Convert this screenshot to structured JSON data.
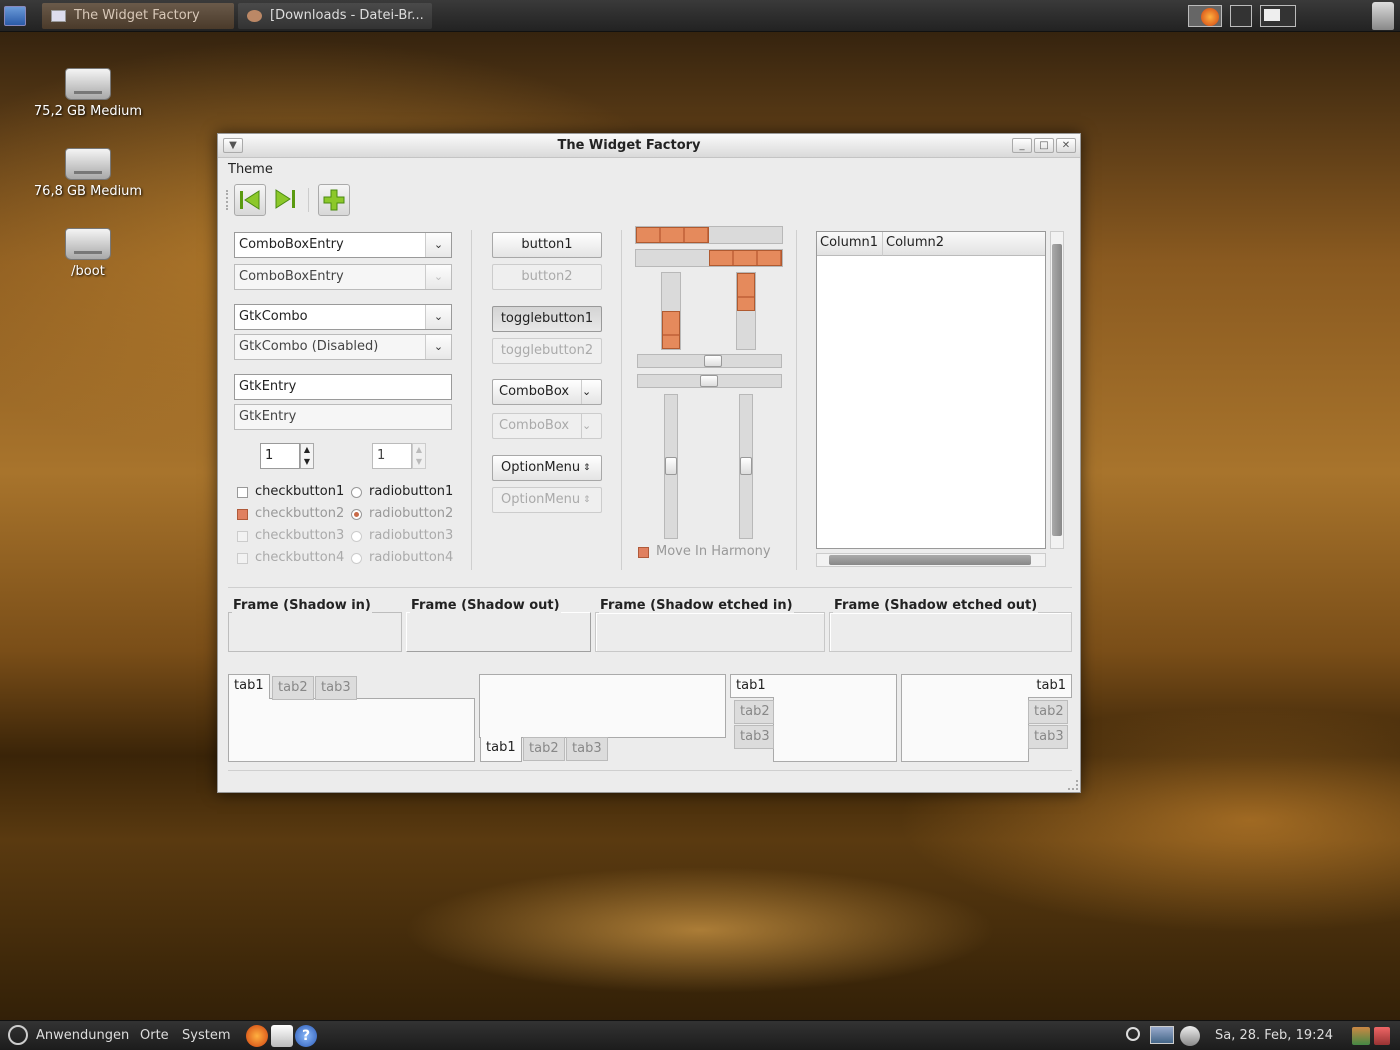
{
  "top_panel": {
    "tasks": [
      {
        "label": "The Widget Factory"
      },
      {
        "label": "[Downloads - Datei-Br..."
      }
    ]
  },
  "desktop": {
    "icons": [
      {
        "label": "75,2 GB Medium"
      },
      {
        "label": "76,8 GB Medium"
      },
      {
        "label": "/boot"
      }
    ]
  },
  "window": {
    "title": "The Widget Factory",
    "menu": {
      "theme": "Theme"
    },
    "left": {
      "combo_entry_1": "ComboBoxEntry",
      "combo_entry_2": "ComboBoxEntry",
      "gtk_combo": "GtkCombo",
      "gtk_combo_disabled": "GtkCombo (Disabled)",
      "entry_1": "GtkEntry",
      "entry_2": "GtkEntry",
      "spin_1": "1",
      "spin_2": "1",
      "checkbuttons": [
        "checkbutton1",
        "checkbutton2",
        "checkbutton3",
        "checkbutton4"
      ],
      "radiobuttons": [
        "radiobutton1",
        "radiobutton2",
        "radiobutton3",
        "radiobutton4"
      ]
    },
    "middle": {
      "button1": "button1",
      "button2": "button2",
      "togglebutton1": "togglebutton1",
      "togglebutton2": "togglebutton2",
      "combobox_1": "ComboBox",
      "combobox_2": "ComboBox",
      "optionmenu_1": "OptionMenu",
      "optionmenu_2": "OptionMenu"
    },
    "ranges": {
      "progress_h1": 0.5,
      "progress_h2": 0.5,
      "progress_v1": 0.5,
      "progress_v2": 0.5,
      "move_in_harmony": "Move In Harmony"
    },
    "tree": {
      "columns": [
        "Column1",
        "Column2"
      ]
    },
    "frames": [
      "Frame (Shadow in)",
      "Frame (Shadow out)",
      "Frame (Shadow etched in)",
      "Frame (Shadow etched out)"
    ],
    "notebook_tabs": [
      "tab1",
      "tab2",
      "tab3"
    ]
  },
  "bottom_panel": {
    "applications": "Anwendungen",
    "places": "Orte",
    "system": "System",
    "clock": "Sa, 28. Feb, 19:24"
  }
}
